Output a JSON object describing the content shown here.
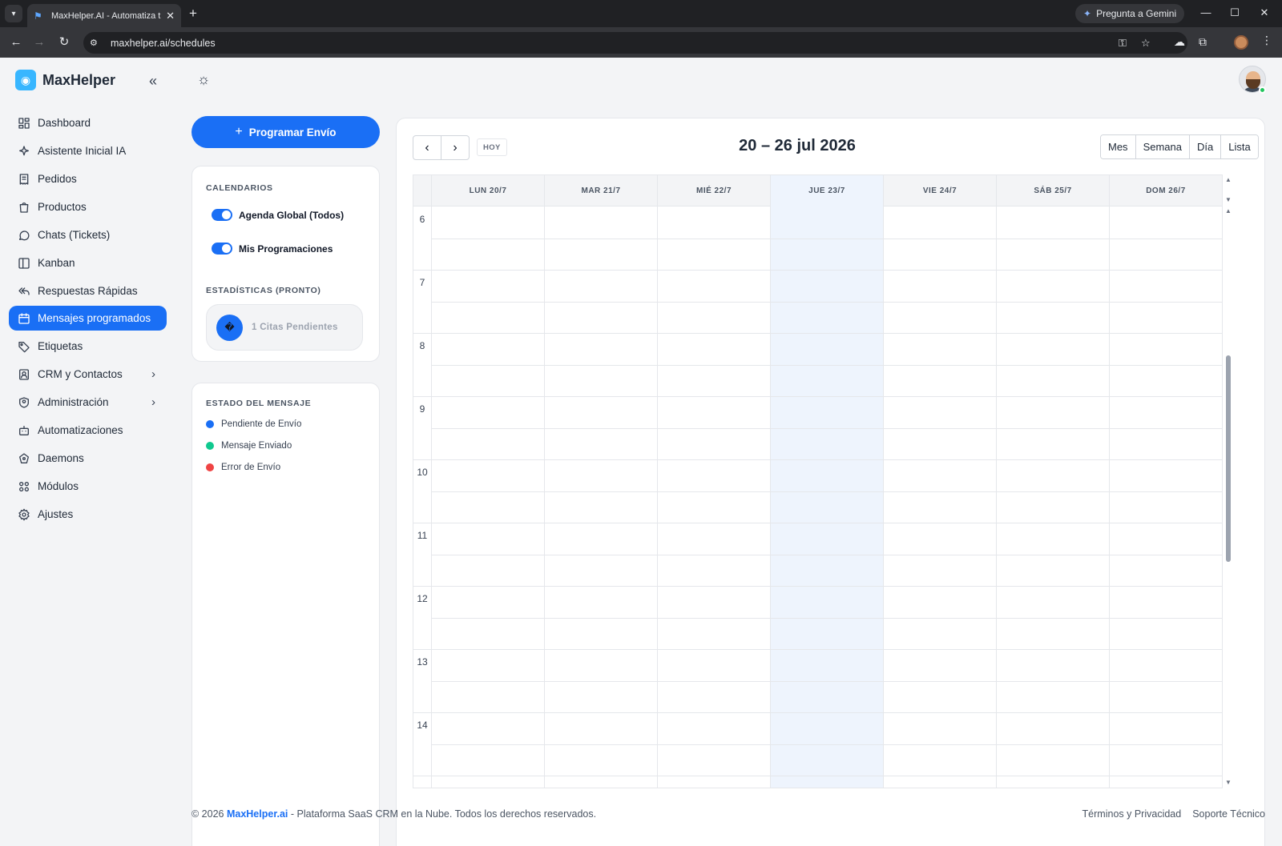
{
  "browser": {
    "tab_title": "MaxHelper.AI - Automatiza tu",
    "gemini_label": "Pregunta a Gemini",
    "url": "maxhelper.ai/schedules"
  },
  "sidebar": {
    "brand": "MaxHelper",
    "items": [
      {
        "label": "Dashboard",
        "icon": "dashboard-icon"
      },
      {
        "label": "Asistente Inicial IA",
        "icon": "sparkle-icon"
      },
      {
        "label": "Pedidos",
        "icon": "receipt-icon"
      },
      {
        "label": "Productos",
        "icon": "shopping-bag-icon"
      },
      {
        "label": "Chats (Tickets)",
        "icon": "whatsapp-icon"
      },
      {
        "label": "Kanban",
        "icon": "kanban-icon"
      },
      {
        "label": "Respuestas Rápidas",
        "icon": "reply-all-icon"
      },
      {
        "label": "Mensajes programados",
        "icon": "calendar-icon",
        "active": true
      },
      {
        "label": "Etiquetas",
        "icon": "tag-icon"
      },
      {
        "label": "CRM y Contactos",
        "icon": "contacts-icon",
        "expandable": true
      },
      {
        "label": "Administración",
        "icon": "shield-user-icon",
        "expandable": true
      },
      {
        "label": "Automatizaciones",
        "icon": "robot-icon"
      },
      {
        "label": "Daemons",
        "icon": "daemon-icon"
      },
      {
        "label": "Módulos",
        "icon": "modules-icon"
      },
      {
        "label": "Ajustes",
        "icon": "gear-icon"
      }
    ]
  },
  "left_panel": {
    "program_button": "Programar Envío",
    "calendars_label": "CALENDARIOS",
    "calendars": [
      {
        "label": "Agenda Global (Todos)",
        "enabled": true
      },
      {
        "label": "Mis Programaciones",
        "enabled": true
      }
    ],
    "stats_label": "ESTADÍSTICAS (PRONTO)",
    "stat_icon_glyph": "�",
    "stat_text": "1 Citas Pendientes",
    "status_label": "ESTADO DEL MENSAJE",
    "statuses": [
      {
        "label": "Pendiente de Envío",
        "color": "#1a6ff5"
      },
      {
        "label": "Mensaje Enviado",
        "color": "#10c98f"
      },
      {
        "label": "Error de Envío",
        "color": "#ef4444"
      }
    ]
  },
  "calendar": {
    "today_button": "HOY",
    "title": "20 – 26 jul 2026",
    "views": [
      "Mes",
      "Semana",
      "Día",
      "Lista"
    ],
    "days": [
      "LUN 20/7",
      "MAR 21/7",
      "MIÉ 22/7",
      "JUE 23/7",
      "VIE 24/7",
      "SÁB 25/7",
      "DOM 26/7"
    ],
    "today_index": 3,
    "hours": [
      "6",
      "7",
      "8",
      "9",
      "10",
      "11",
      "12",
      "13",
      "14"
    ],
    "today_highlight": "#eef4fd"
  },
  "footer": {
    "copyright_prefix": "© 2026 ",
    "brand_link": "MaxHelper.ai",
    "copyright_suffix": " - Plataforma SaaS CRM en la Nube. Todos los derechos reservados.",
    "terms": "Términos y Privacidad",
    "support": "Soporte Técnico"
  }
}
